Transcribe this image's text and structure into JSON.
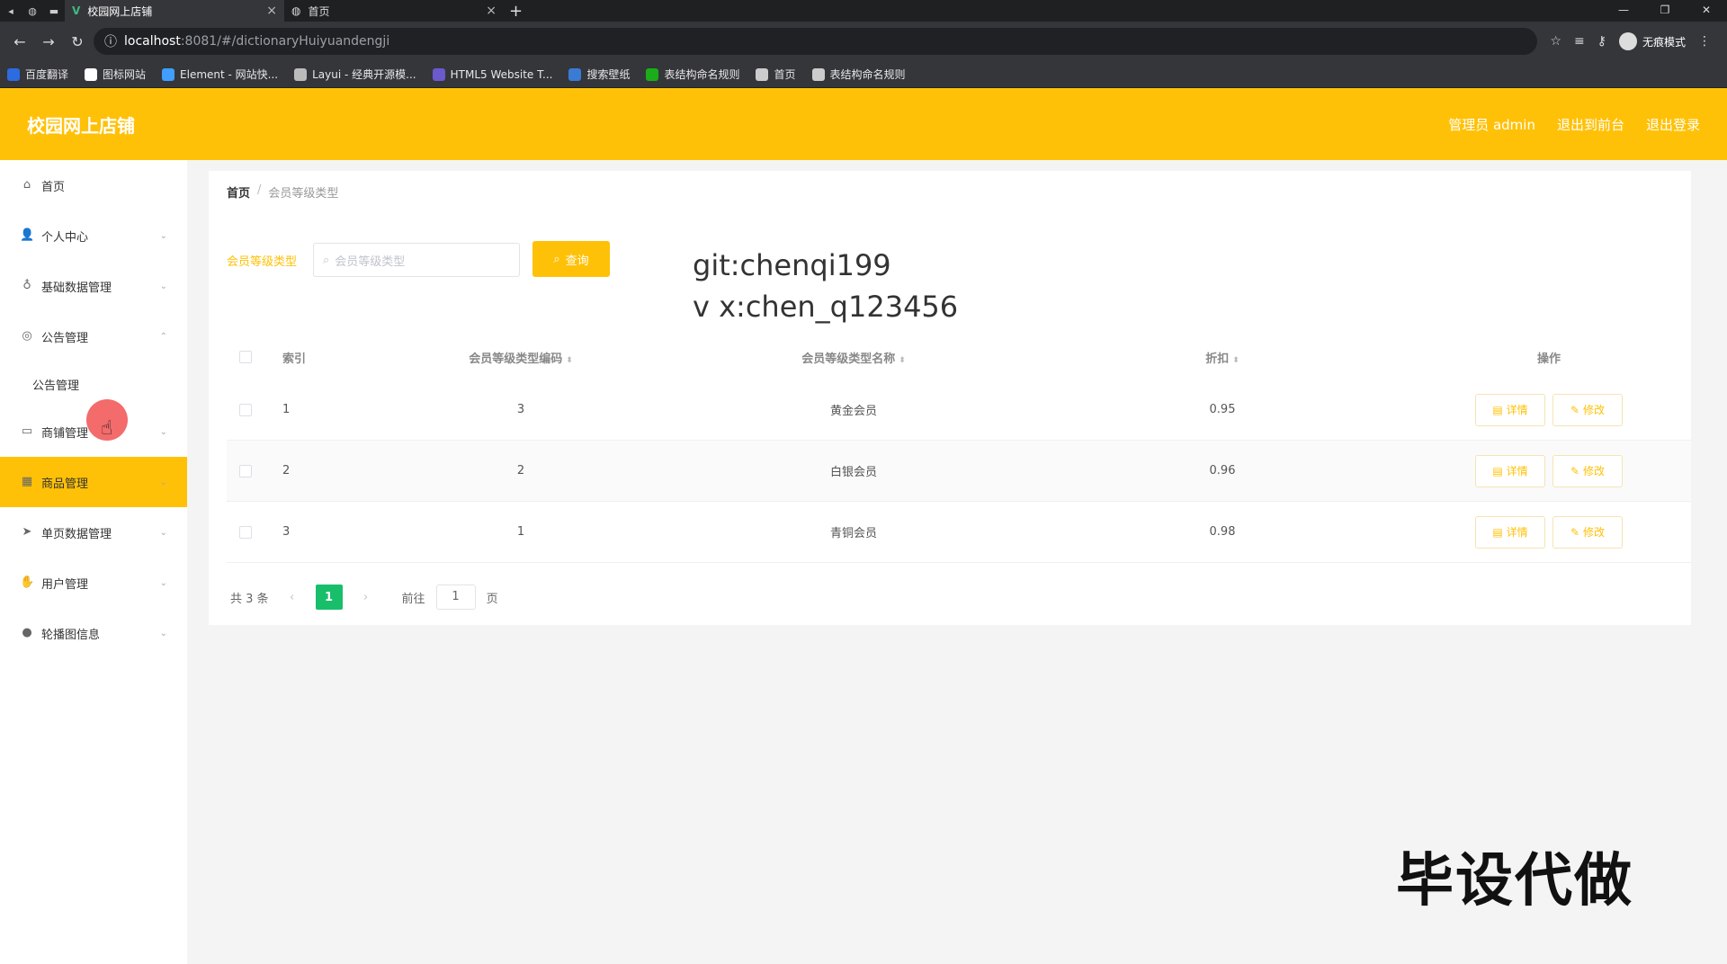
{
  "browser": {
    "tabs": [
      {
        "title": "校园网上店铺",
        "active": true
      },
      {
        "title": "首页",
        "active": false
      }
    ],
    "url_host": "localhost",
    "url_path": ":8081/#/dictionaryHuiyuandengji",
    "incognito_label": "无痕模式",
    "bookmarks": [
      {
        "label": "百度翻译",
        "color": "#2c6be0"
      },
      {
        "label": "图标网站",
        "color": "#ffffff"
      },
      {
        "label": "Element - 网站快...",
        "color": "#409eff"
      },
      {
        "label": "Layui - 经典开源模...",
        "color": "#bbbbbb"
      },
      {
        "label": "HTML5 Website T...",
        "color": "#6a5acd"
      },
      {
        "label": "搜索壁纸",
        "color": "#3a7bd5"
      },
      {
        "label": "表结构命名规则",
        "color": "#1aad19"
      },
      {
        "label": "首页",
        "color": "#cccccc"
      },
      {
        "label": "表结构命名规则",
        "color": "#cccccc"
      }
    ]
  },
  "header": {
    "title": "校园网上店铺",
    "user": "管理员 admin",
    "front": "退出到前台",
    "logout": "退出登录"
  },
  "sidebar": {
    "items": [
      {
        "label": "首页",
        "icon": "home-icon",
        "glyph": "⌂",
        "chev": ""
      },
      {
        "label": "个人中心",
        "icon": "user-icon",
        "glyph": "👤",
        "chev": "⌄"
      },
      {
        "label": "基础数据管理",
        "icon": "mic-icon",
        "glyph": "♁",
        "chev": "⌄"
      },
      {
        "label": "公告管理",
        "icon": "globe-icon",
        "glyph": "◎",
        "chev": "⌃"
      },
      {
        "label": "公告管理",
        "icon": "",
        "glyph": "",
        "chev": "",
        "sub": true
      },
      {
        "label": "商铺管理",
        "icon": "shop-icon",
        "glyph": "▭",
        "chev": "⌄"
      },
      {
        "label": "商品管理",
        "icon": "grid-icon",
        "glyph": "▦",
        "chev": "⌄",
        "active": true
      },
      {
        "label": "单页数据管理",
        "icon": "send-icon",
        "glyph": "➤",
        "chev": "⌄"
      },
      {
        "label": "用户管理",
        "icon": "thumb-icon",
        "glyph": "✋",
        "chev": "⌄"
      },
      {
        "label": "轮播图信息",
        "icon": "pin-icon",
        "glyph": "●",
        "chev": "⌄"
      }
    ]
  },
  "breadcrumb": {
    "home": "首页",
    "sep": "/",
    "current": "会员等级类型"
  },
  "search": {
    "label": "会员等级类型",
    "placeholder": "会员等级类型",
    "button": "查询"
  },
  "watermark": {
    "line1": "git:chenqi199",
    "line2": "v x:chen_q123456"
  },
  "table": {
    "headers": {
      "index": "索引",
      "code": "会员等级类型编码",
      "name": "会员等级类型名称",
      "discount": "折扣",
      "ops": "操作"
    },
    "rows": [
      {
        "index": "1",
        "code": "3",
        "name": "黄金会员",
        "discount": "0.95"
      },
      {
        "index": "2",
        "code": "2",
        "name": "白银会员",
        "discount": "0.96"
      },
      {
        "index": "3",
        "code": "1",
        "name": "青铜会员",
        "discount": "0.98"
      }
    ],
    "detail_label": "详情",
    "edit_label": "修改"
  },
  "pager": {
    "total": "共 3 条",
    "prev": "‹",
    "current": "1",
    "next": "›",
    "goto_label": "前往",
    "goto_value": "1",
    "page_unit": "页"
  },
  "stamp": "毕设代做"
}
